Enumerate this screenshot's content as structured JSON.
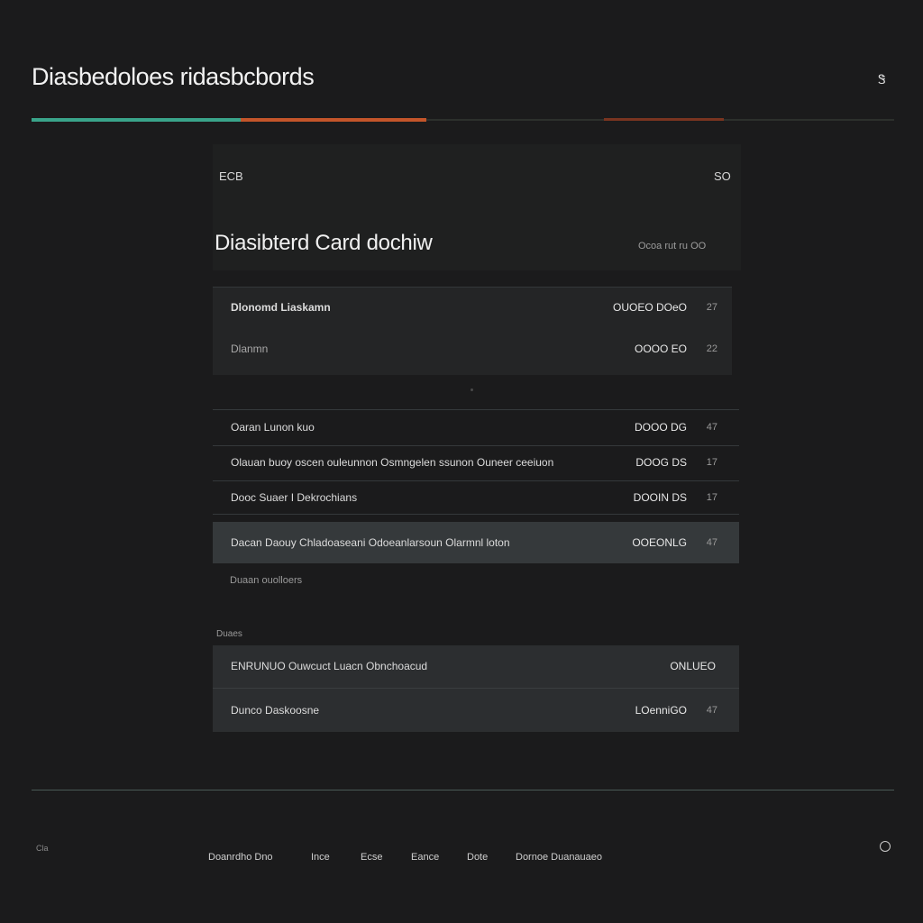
{
  "app": {
    "title": "Diasbedoloes ridasbcbords",
    "top_icon": "Ꮥ"
  },
  "progress": {
    "segments": [
      {
        "color": "#3aa48a",
        "fraction": 0.24
      },
      {
        "color": "#c4552a",
        "fraction": 0.22
      }
    ]
  },
  "card": {
    "code": "ECB",
    "count": "SO",
    "title": "Diasibterd Card dochiw",
    "meta": "Ocoa rut ru OO"
  },
  "rows": [
    {
      "label": "Dlonomd Liaskamn",
      "value": "OUOEO DOeO",
      "num": "27"
    },
    {
      "label": "Dlanmn",
      "value": "OOOO EO",
      "num": "22"
    },
    {
      "label": "Oaran Lunon kuo",
      "value": "DOOO DG",
      "num": "47"
    },
    {
      "label": "Olauan buoy oscen ouleunnon Osmngelen ssunon Ouneer ceeiuon",
      "value": "DOOG DS",
      "num": "17"
    },
    {
      "label": "Dooc Suaer I Dekrochians",
      "value": "DOOIN DS",
      "num": "17"
    },
    {
      "label": "Dacan Daouy Chladoaseani Odoeanlarsoun Olarmnl loton",
      "value": "OOEONLG",
      "num": "47"
    }
  ],
  "subnote": "Duaan ouolloers",
  "section": {
    "label": "Duaes",
    "rows": [
      {
        "label": "ENRUNUO Ouwcuct Luacn Obnchoacud",
        "value": "ONLUEO",
        "num": ""
      },
      {
        "label": "Dunco Daskoosne",
        "value": "LOenniGO",
        "num": "47"
      }
    ]
  },
  "footer": {
    "left": "Cla",
    "links": [
      "Doanrdho Dno",
      "Ince",
      "Ecse",
      "Eance",
      "Dote",
      "Dornoe Duanauaeo"
    ]
  },
  "colors": {
    "background": "#1b1b1c",
    "accent_teal": "#3aa48a",
    "accent_orange": "#c4552a"
  }
}
